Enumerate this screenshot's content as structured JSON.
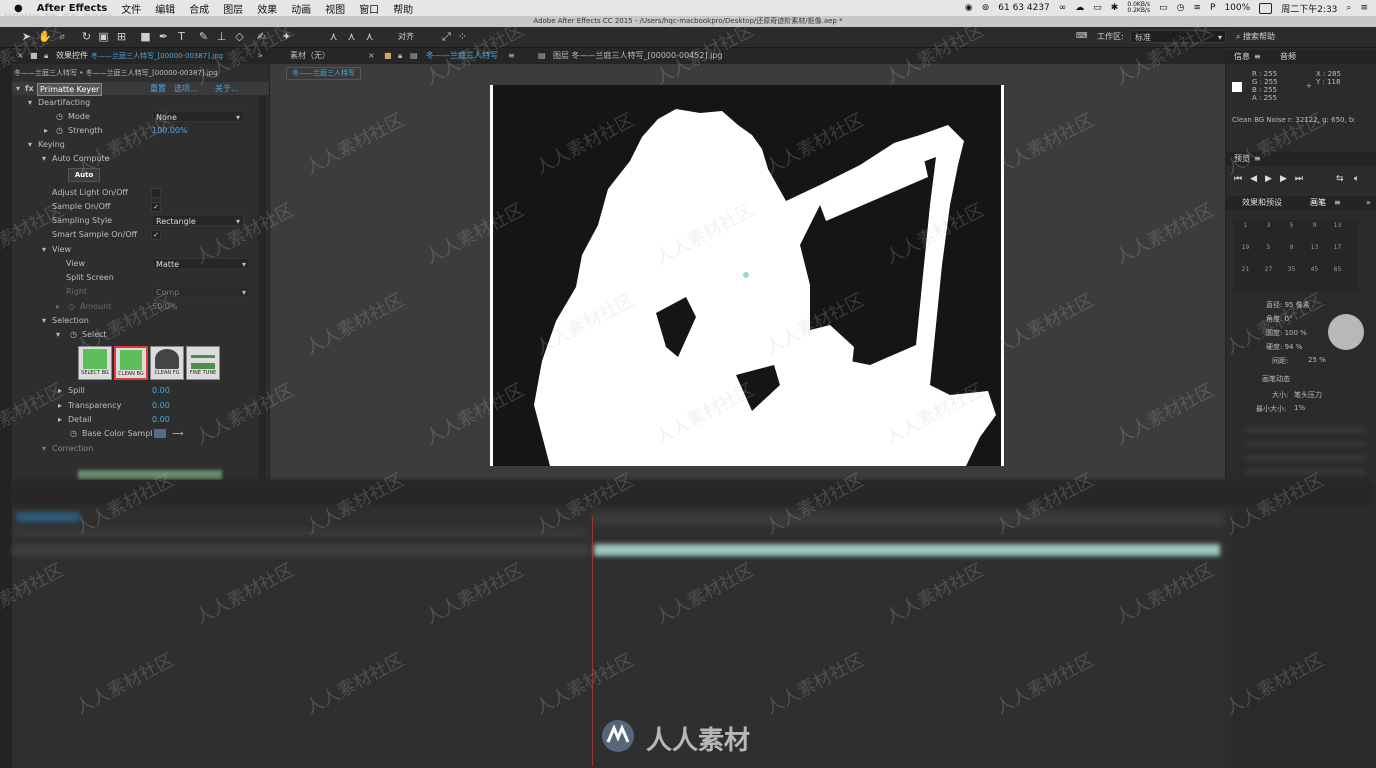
{
  "menubar": {
    "apple": "",
    "app_name": "After Effects",
    "items": [
      "文件",
      "编辑",
      "合成",
      "图层",
      "效果",
      "动画",
      "视图",
      "窗口",
      "帮助"
    ],
    "status_left_text": "61 63 4237",
    "net_speed": "0.0KB/s",
    "net_speed2": "0.2KB/s",
    "battery": "100%",
    "clock": "周二下午2:33",
    "watermark": "www.rr-sc.com"
  },
  "titlebar": {
    "title": "Adobe After Effects CC 2015 - /Users/hqc-macbookpro/Desktop/还原奇迹阶素材/抠像.aep *"
  },
  "toolbar": {
    "align_label": "对齐",
    "workspace_label": "工作区:",
    "workspace_value": "标准",
    "search_label": "搜索帮助"
  },
  "effects": {
    "tab_label": "效果控件",
    "tab_file": "冬——兰庭三人特写_[00000-00387].jpg",
    "breadcrumb": "冬——兰庭三人特写 • 冬——兰庭三人特写_[00000-00387].jpg",
    "fx_name": "Primatte Keyer",
    "reset": "重置",
    "options": "选项...",
    "about": "关于...",
    "rows": {
      "deartifacting": "Deartifacting",
      "mode": "Mode",
      "mode_value": "None",
      "strength": "Strength",
      "strength_value": "100.00%",
      "keying": "Keying",
      "auto_compute": "Auto Compute",
      "auto_btn": "Auto",
      "adjust_light": "Adjust Light On/Off",
      "sample_onoff": "Sample On/Off",
      "sampling_style": "Sampling Style",
      "sampling_value": "Rectangle",
      "smart_sample": "Smart Sample On/Off",
      "view_group": "View",
      "view": "View",
      "view_value": "Matte",
      "split_screen": "Split Screen",
      "right": "Right",
      "right_value": "Comp",
      "amount": "Amount",
      "amount_value": "50.0%",
      "selection": "Selection",
      "select": "Select",
      "spill": "Spill",
      "spill_value": "0.00",
      "transparency": "Transparency",
      "transparency_value": "0.00",
      "detail": "Detail",
      "detail_value": "0.00",
      "base_color": "Base Color Sampl",
      "correction": "Correction"
    },
    "select_buttons": [
      "SELECT BG",
      "CLEAN BG",
      "CLEAN FG",
      "FINE TUNE"
    ]
  },
  "viewer": {
    "tab_footage": "素材（无）",
    "tab_comp": "冬——兰庭三人特写",
    "tab_layer": "图层 冬——兰庭三人特写_[00000-00452].jpg",
    "subtab": "冬——兰庭三人特写"
  },
  "info_panel": {
    "tab_info": "信息",
    "tab_audio": "音频",
    "r": "R : 255",
    "g": "G : 255",
    "b": "B : 255",
    "a": "A : 255",
    "x": "X : 285",
    "y": "Y : 118",
    "status": "Clean BG Noise  r: 32122, g: 650, b:"
  },
  "preview_panel": {
    "title": "预览"
  },
  "brush_panel": {
    "tab_effects": "效果和预设",
    "tab_brush": "画笔",
    "sizes": [
      "1",
      "3",
      "5",
      "9",
      "13",
      "19",
      "5",
      "9",
      "13",
      "17",
      "21",
      "27",
      "35",
      "45",
      "65"
    ],
    "diameter": "直径: 95 像素",
    "angle": "角度: 0°",
    "roundness": "圆度: 100 %",
    "hardness": "硬度: 94 %",
    "spacing": "间距:",
    "spacing_value": "25 %",
    "dynamics": "画笔动态",
    "size": "大小:",
    "size_value": "笔头压力",
    "min_size": "最小大小:",
    "min_size_value": "1%"
  },
  "watermark": {
    "text": "人人素材社区",
    "logo_text": "人人素材"
  },
  "colors": {
    "accent": "#4ba7e0",
    "panel": "#2e2e2e",
    "canvas_bg": "#161616",
    "matte": "#ffffff",
    "timeline_bar": "#9cc5bb",
    "red_swatch": "#e02020"
  }
}
